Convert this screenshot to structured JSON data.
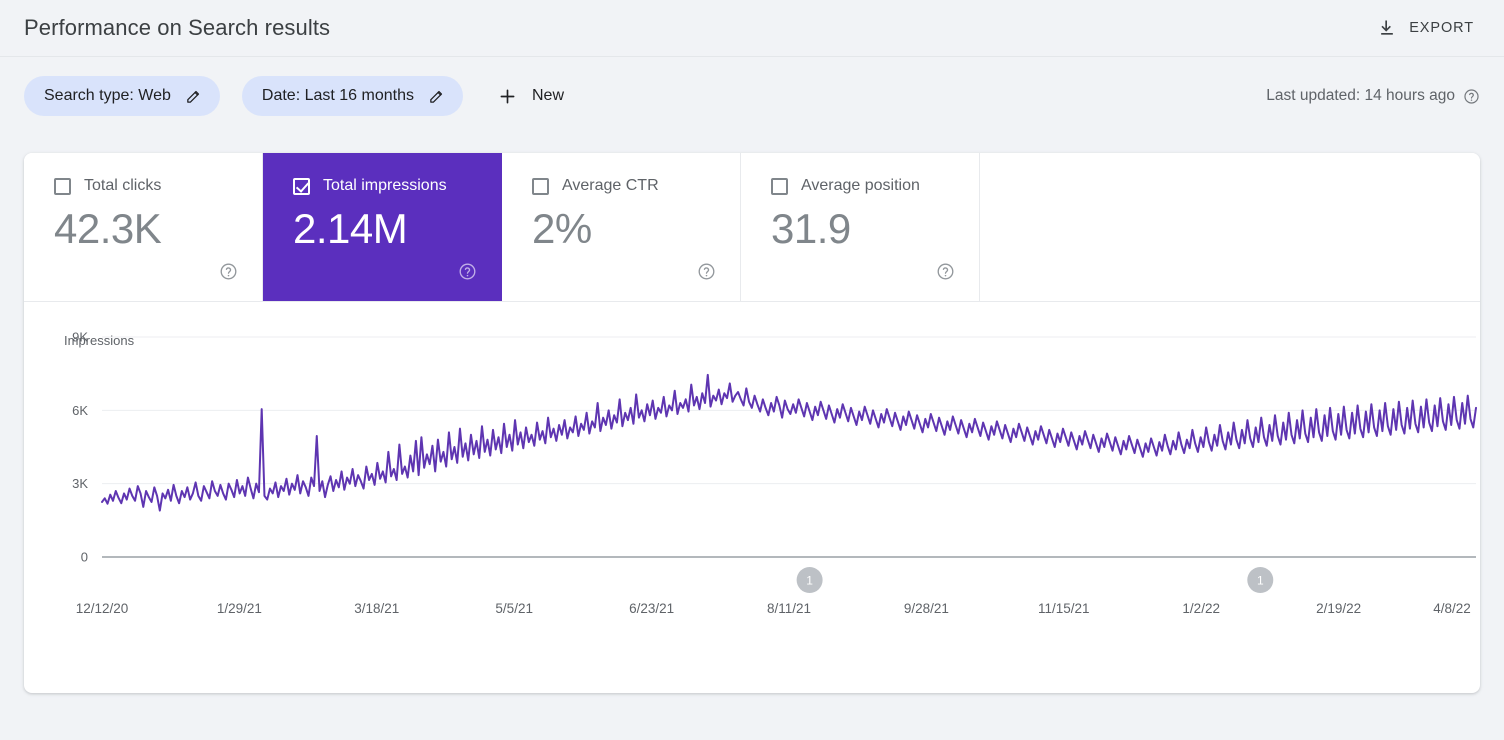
{
  "header": {
    "title": "Performance on Search results",
    "export_label": "EXPORT",
    "export_icon": "download-icon"
  },
  "filters": {
    "chips": [
      {
        "label": "Search type: Web",
        "icon": "pencil-icon"
      },
      {
        "label": "Date: Last 16 months",
        "icon": "pencil-icon"
      }
    ],
    "new_label": "New",
    "new_icon": "plus-icon",
    "last_updated": "Last updated: 14 hours ago",
    "help_icon": "help-icon"
  },
  "metrics": [
    {
      "label": "Total clicks",
      "value": "42.3K",
      "checked": false
    },
    {
      "label": "Total impressions",
      "value": "2.14M",
      "checked": true
    },
    {
      "label": "Average CTR",
      "value": "2%",
      "checked": false
    },
    {
      "label": "Average position",
      "value": "31.9",
      "checked": false
    }
  ],
  "colors": {
    "accent_purple": "#5b2fbe",
    "line_purple": "#5e35b1",
    "chip_blue": "#d9e3fb",
    "page_bg": "#f1f3f6"
  },
  "annotations": [
    {
      "label": "1",
      "x_ratio": 0.515
    },
    {
      "label": "1",
      "x_ratio": 0.843
    }
  ],
  "chart_data": {
    "type": "line",
    "title": "",
    "series_label": "Impressions",
    "xlabel": "",
    "ylabel": "Impressions",
    "ylim": [
      0,
      9000
    ],
    "yticks": [
      0,
      3000,
      6000,
      9000
    ],
    "ytick_labels": [
      "0",
      "3K",
      "6K",
      "9K"
    ],
    "grid": true,
    "legend": "none",
    "line_color": "#5e35b1",
    "xtick_labels": [
      "12/12/20",
      "1/29/21",
      "3/18/21",
      "5/5/21",
      "6/23/21",
      "8/11/21",
      "9/28/21",
      "11/15/21",
      "1/2/22",
      "2/19/22",
      "4/8/22"
    ],
    "x_start": "12/12/20",
    "x_end": "4/8/22",
    "values": [
      2250,
      2400,
      2180,
      2550,
      2300,
      2700,
      2420,
      2200,
      2600,
      2350,
      2800,
      2500,
      2300,
      2900,
      2600,
      2050,
      2700,
      2450,
      2250,
      2850,
      2500,
      1900,
      2600,
      2400,
      2750,
      2300,
      2950,
      2500,
      2200,
      2700,
      2450,
      2850,
      2350,
      2600,
      3050,
      2500,
      2300,
      2900,
      2650,
      2400,
      3100,
      2700,
      2500,
      2950,
      2600,
      2350,
      3000,
      2750,
      2450,
      3150,
      2600,
      2900,
      2500,
      3250,
      2800,
      2400,
      3000,
      2650,
      6050,
      2500,
      2350,
      2800,
      2600,
      3050,
      2450,
      2900,
      2700,
      3200,
      2550,
      3000,
      2750,
      3350,
      2600,
      3100,
      2850,
      2500,
      3250,
      2900,
      4950,
      2700,
      3100,
      2450,
      2950,
      3300,
      2700,
      3150,
      2850,
      3500,
      2750,
      3250,
      3000,
      3600,
      2900,
      3350,
      3100,
      2800,
      3700,
      3150,
      3400,
      2950,
      3850,
      3200,
      3500,
      3050,
      4300,
      3300,
      3600,
      3150,
      4600,
      3400,
      3700,
      3250,
      4150,
      3500,
      4750,
      3350,
      4900,
      3650,
      4200,
      3800,
      4550,
      3500,
      4800,
      3900,
      4300,
      3700,
      5100,
      4000,
      4500,
      3850,
      5250,
      4100,
      4650,
      3950,
      5000,
      4200,
      4750,
      4050,
      5350,
      4300,
      4800,
      4150,
      5200,
      4400,
      4900,
      4250,
      5450,
      4500,
      5000,
      4350,
      5600,
      4600,
      5100,
      4450,
      5300,
      4700,
      5000,
      4550,
      5500,
      4800,
      5150,
      4650,
      5700,
      4900,
      5250,
      4750,
      5400,
      5000,
      5600,
      4850,
      5300,
      5100,
      5750,
      4950,
      5450,
      5200,
      5900,
      5050,
      5550,
      5300,
      6300,
      5150,
      5700,
      5400,
      6000,
      5250,
      5800,
      5500,
      6450,
      5350,
      5900,
      5600,
      6100,
      5450,
      6650,
      5700,
      6000,
      5550,
      6250,
      5800,
      6400,
      5650,
      6100,
      5900,
      6550,
      5750,
      6200,
      6000,
      6800,
      5850,
      6300,
      6100,
      6450,
      5950,
      7050,
      6200,
      6550,
      6050,
      6700,
      6300,
      7450,
      6150,
      6600,
      6400,
      6850,
      6250,
      6700,
      6500,
      7100,
      6350,
      6600,
      6750,
      6450,
      6200,
      6900,
      6350,
      6100,
      6600,
      6250,
      5950,
      6450,
      6100,
      5800,
      6300,
      5950,
      6550,
      6200,
      5700,
      6400,
      6050,
      5850,
      6250,
      5900,
      6450,
      6100,
      5750,
      6300,
      5950,
      5600,
      6150,
      5800,
      6350,
      6000,
      5650,
      6200,
      5850,
      5500,
      6050,
      5700,
      6250,
      5900,
      5550,
      6100,
      5750,
      5400,
      5950,
      5600,
      6150,
      5800,
      5450,
      6000,
      5650,
      5300,
      5850,
      5500,
      6050,
      5700,
      5350,
      5900,
      5550,
      5200,
      5750,
      5400,
      5950,
      5600,
      5250,
      5800,
      5450,
      5100,
      5650,
      5300,
      5850,
      5500,
      5150,
      5700,
      5350,
      5000,
      5550,
      5200,
      5750,
      5400,
      5050,
      5600,
      5250,
      4900,
      5450,
      5100,
      5650,
      5300,
      4950,
      5500,
      5150,
      4800,
      5350,
      5000,
      5550,
      5200,
      4850,
      5400,
      5050,
      4700,
      5250,
      4900,
      5450,
      5100,
      4750,
      5300,
      4950,
      4600,
      5150,
      4800,
      5350,
      5000,
      4650,
      5200,
      4850,
      4500,
      5050,
      4700,
      5250,
      4900,
      4550,
      5100,
      4750,
      4400,
      4950,
      4600,
      5150,
      4800,
      4450,
      5000,
      4650,
      4300,
      4850,
      4500,
      5050,
      4700,
      4350,
      4900,
      4550,
      4200,
      4750,
      4400,
      4950,
      4600,
      4250,
      4800,
      4450,
      4100,
      4650,
      4300,
      4850,
      4500,
      4150,
      4700,
      4350,
      5000,
      4550,
      4200,
      4750,
      4400,
      5100,
      4600,
      4250,
      4800,
      4450,
      5200,
      4650,
      4300,
      4900,
      4500,
      5300,
      4700,
      4350,
      5000,
      4550,
      5400,
      4750,
      4400,
      5100,
      4600,
      5500,
      4800,
      4450,
      5200,
      4650,
      5600,
      4850,
      4500,
      5300,
      4700,
      5700,
      4900,
      4550,
      5400,
      4750,
      5800,
      4950,
      4600,
      5500,
      4800,
      5900,
      5000,
      4650,
      5600,
      4850,
      6000,
      5050,
      4700,
      5700,
      4900,
      6050,
      5100,
      4750,
      5800,
      4950,
      6100,
      5150,
      4800,
      5850,
      5000,
      6150,
      5200,
      4850,
      5900,
      5050,
      6200,
      5250,
      4900,
      5950,
      5100,
      6250,
      5300,
      4950,
      6000,
      5150,
      6300,
      5350,
      5000,
      6050,
      5200,
      6350,
      5400,
      5050,
      6100,
      5250,
      6400,
      5450,
      5100,
      6150,
      5300,
      6450,
      5500,
      5150,
      6200,
      5350,
      6500,
      5550,
      5200,
      6250,
      5400,
      6550,
      5600,
      5250,
      6300,
      5450,
      6600,
      5650,
      5300,
      6100
    ]
  }
}
